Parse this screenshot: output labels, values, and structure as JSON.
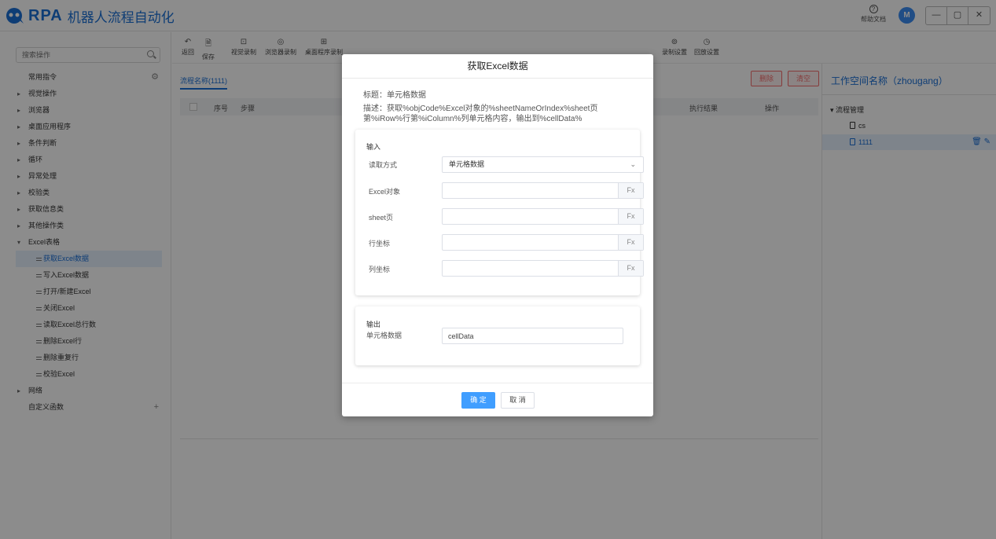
{
  "header": {
    "logo_text": "RPA",
    "app_title": "机器人流程自动化",
    "help_label": "帮助文档",
    "avatar_letter": "M",
    "win_min": "—",
    "win_restore": "▢",
    "win_close": "✕"
  },
  "sidebar": {
    "search_placeholder": "搜索操作",
    "items": [
      {
        "label": "常用指令"
      },
      {
        "label": "视觉操作"
      },
      {
        "label": "浏览器"
      },
      {
        "label": "桌面应用程序"
      },
      {
        "label": "条件判断"
      },
      {
        "label": "循环"
      },
      {
        "label": "异常处理"
      },
      {
        "label": "校验类"
      },
      {
        "label": "获取信息类"
      },
      {
        "label": "其他操作类"
      },
      {
        "label": "Excel表格"
      },
      {
        "label": "获取Excel数据"
      },
      {
        "label": "写入Excel数据"
      },
      {
        "label": "打开/新建Excel"
      },
      {
        "label": "关闭Excel"
      },
      {
        "label": "读取Excel总行数"
      },
      {
        "label": "删除Excel行"
      },
      {
        "label": "删除重复行"
      },
      {
        "label": "校验Excel"
      },
      {
        "label": "网络"
      },
      {
        "label": "自定义函数"
      }
    ]
  },
  "toolbar": {
    "tools": [
      {
        "label": "返回",
        "icon": "↶"
      },
      {
        "label": "保存",
        "icon": "🗎"
      },
      {
        "label": "视觉录制",
        "icon": "⊡"
      },
      {
        "label": "浏览器录制",
        "icon": "◎"
      },
      {
        "label": "桌面程序录制",
        "icon": "⊞"
      },
      {
        "label": "录制设置",
        "icon": "⊚"
      },
      {
        "label": "回放设置",
        "icon": "◷"
      }
    ]
  },
  "main": {
    "tab_label": "流程名称(1111)",
    "delete_label": "删除",
    "clear_label": "清空",
    "columns": [
      "序号",
      "步骤",
      "执行结果",
      "操作"
    ]
  },
  "right_panel": {
    "title": "工作空间名称（zhougang）",
    "group_label": "流程管理",
    "files": [
      "cs",
      "1111"
    ]
  },
  "modal": {
    "title": "获取Excel数据",
    "subtitle": "标题：单元格数据",
    "description": "描述：获取%objCode%Excel对象的%sheetNameOrIndex%sheet页第%iRow%行第%iColumn%列单元格内容，输出到%cellData%",
    "input_header": "输入",
    "read_mode_label": "读取方式",
    "read_mode_value": "单元格数据",
    "excel_obj_label": "Excel对象",
    "sheet_label": "sheet页",
    "row_label": "行坐标",
    "col_label": "列坐标",
    "fx_label": "Fx",
    "output_header": "输出",
    "output_label": "单元格数据",
    "output_value": "cellData",
    "ok_label": "确 定",
    "cancel_label": "取 消"
  }
}
